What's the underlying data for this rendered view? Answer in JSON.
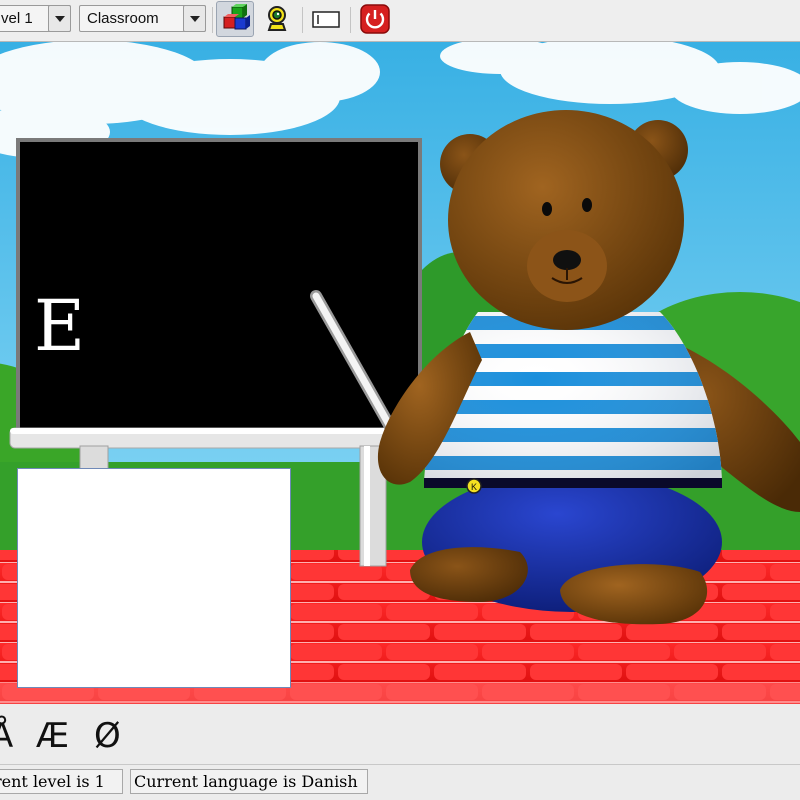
{
  "toolbar": {
    "level_select": {
      "value": "vel 1"
    },
    "scene_select": {
      "value": "Classroom"
    },
    "buttons": [
      {
        "icon": "blocks-icon",
        "pressed": true
      },
      {
        "icon": "webcam-icon",
        "pressed": false
      },
      {
        "icon": "text-field-icon",
        "pressed": false
      },
      {
        "icon": "power-icon",
        "pressed": false
      }
    ]
  },
  "blackboard": {
    "letter": "E"
  },
  "letters": [
    "Å",
    "Æ",
    "Ø"
  ],
  "status": {
    "level_text": "rent level is 1",
    "language_text": "Current language is Danish"
  },
  "colors": {
    "sky": "#3fb4e6",
    "grass": "#2e9a2a",
    "floor_red": "#ee1a1a",
    "blackboard": "#000000",
    "bear_fur": "#7a4a10",
    "shirt_stripe": "#1a8fdc",
    "pants": "#1028a0",
    "power_button": "#d62020"
  }
}
